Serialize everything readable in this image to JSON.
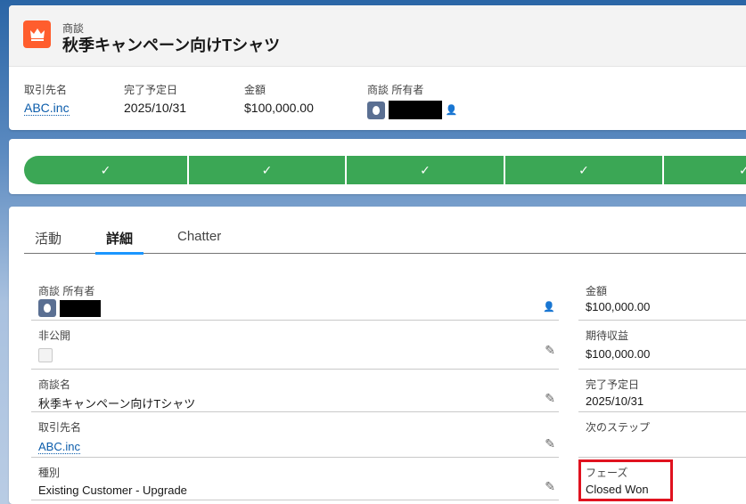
{
  "header": {
    "object_label": "商談",
    "title": "秋季キャンペーン向けTシャツ",
    "icon": "crown-icon",
    "fields": [
      {
        "label": "取引先名",
        "value": "ABC.inc"
      },
      {
        "label": "完了予定日",
        "value": "2025/10/31"
      },
      {
        "label": "金額",
        "value": "$100,000.00"
      },
      {
        "label": "商談 所有者",
        "value": ""
      }
    ]
  },
  "path": {
    "stages_completed": 5,
    "color": "#3ba755"
  },
  "tabs": [
    {
      "label": "活動"
    },
    {
      "label": "詳細",
      "active": true
    },
    {
      "label": "Chatter"
    }
  ],
  "details": {
    "left": [
      {
        "label": "商談 所有者",
        "value": ""
      },
      {
        "label": "非公開",
        "value": ""
      },
      {
        "label": "商談名",
        "value": "秋季キャンペーン向けTシャツ"
      },
      {
        "label": "取引先名",
        "value": "ABC.inc"
      },
      {
        "label": "種別",
        "value": "Existing Customer - Upgrade"
      }
    ],
    "right": [
      {
        "label": "金額",
        "value": "$100,000.00"
      },
      {
        "label": "期待収益",
        "value": "$100,000.00"
      },
      {
        "label": "完了予定日",
        "value": "2025/10/31"
      },
      {
        "label": "次のステップ",
        "value": ""
      },
      {
        "label": "フェーズ",
        "value": "Closed Won"
      }
    ]
  },
  "highlight_color": "#e0121f"
}
